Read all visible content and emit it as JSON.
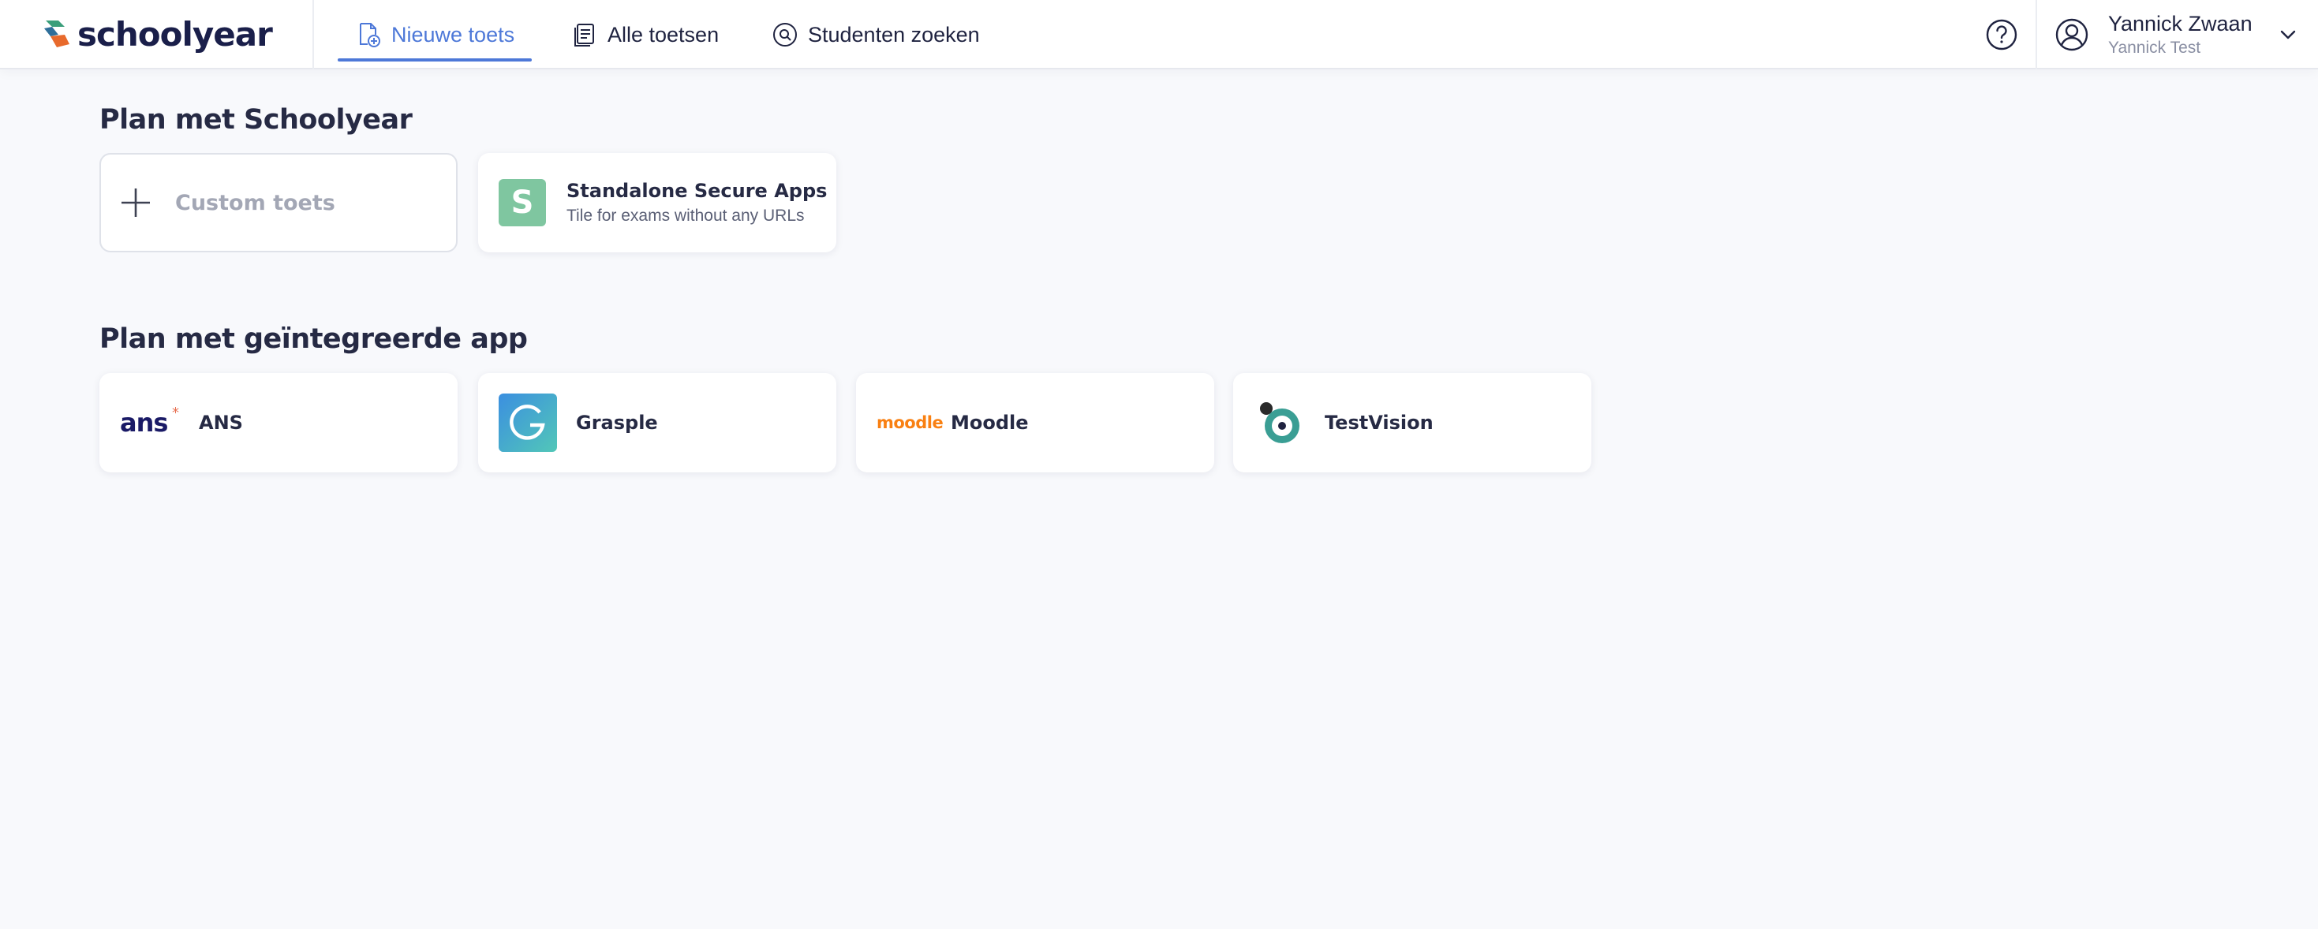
{
  "brand": {
    "name": "schoolyear"
  },
  "nav": {
    "items": [
      {
        "label": "Nieuwe toets",
        "icon": "new-test-icon",
        "active": true
      },
      {
        "label": "Alle toetsen",
        "icon": "tests-list-icon",
        "active": false
      },
      {
        "label": "Studenten zoeken",
        "icon": "search-students-icon",
        "active": false
      }
    ]
  },
  "user": {
    "name": "Yannick Zwaan",
    "subtitle": "Yannick Test"
  },
  "sections": {
    "schoolyear": {
      "title": "Plan met Schoolyear",
      "custom": {
        "label": "Custom toets"
      },
      "standalone": {
        "badge": "S",
        "title": "Standalone Secure Apps",
        "subtitle": "Tile for exams without any URLs"
      }
    },
    "integrated": {
      "title": "Plan met geïntegreerde app",
      "apps": [
        {
          "label": "ANS",
          "logo_text": "ans"
        },
        {
          "label": "Grasple"
        },
        {
          "label": "Moodle",
          "logo_text": "moodle"
        },
        {
          "label": "TestVision"
        }
      ]
    }
  },
  "colors": {
    "accent": "#4d78d8",
    "background": "#f8f9fc",
    "standalone_badge": "#7fc6a0",
    "grasple": "#3fa6d8",
    "moodle": "#f98012",
    "testvision": "#3a9e94"
  }
}
